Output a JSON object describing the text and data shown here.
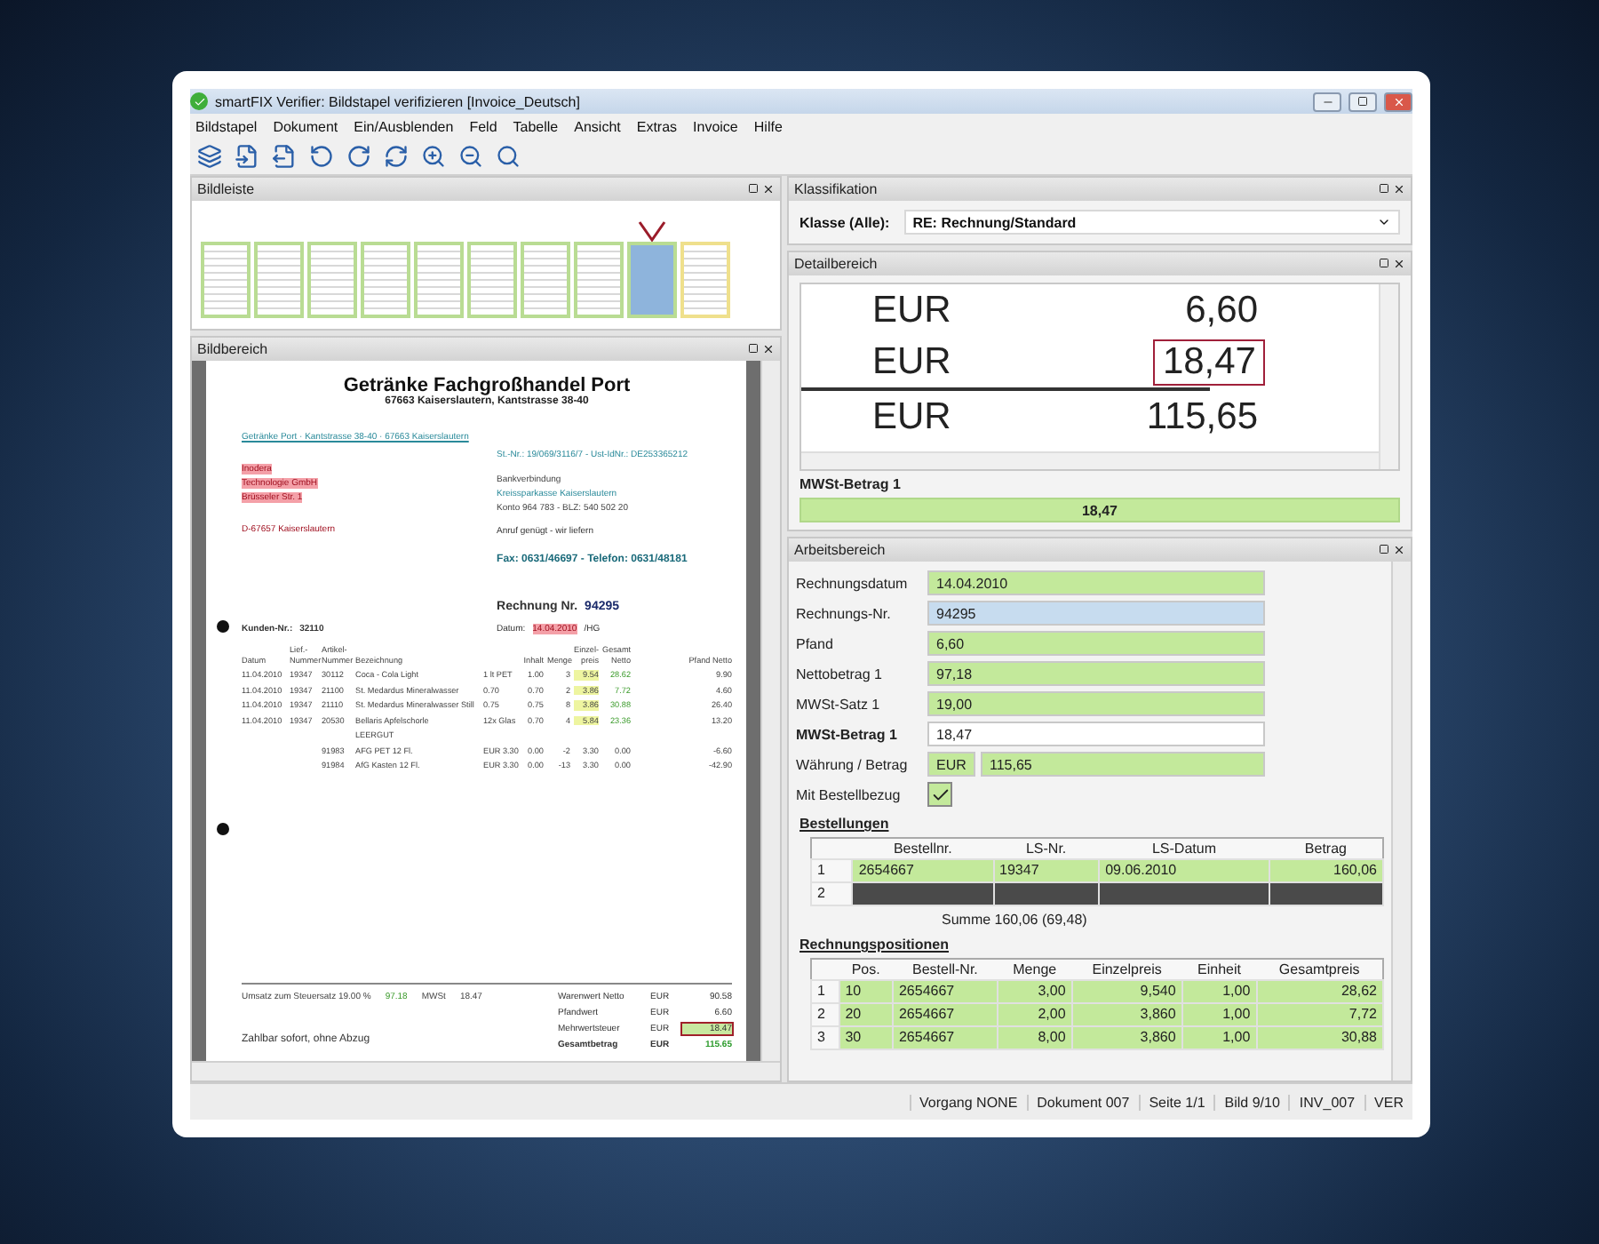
{
  "window": {
    "title": "smartFIX Verifier: Bildstapel verifizieren [Invoice_Deutsch]"
  },
  "menu": [
    "Bildstapel",
    "Dokument",
    "Ein/Ausblenden",
    "Feld",
    "Tabelle",
    "Ansicht",
    "Extras",
    "Invoice",
    "Hilfe"
  ],
  "bildleiste": {
    "title": "Bildleiste",
    "thumbnails": [
      {
        "selected": false,
        "color": "#b9dc93"
      },
      {
        "selected": false,
        "color": "#b9dc93"
      },
      {
        "selected": false,
        "color": "#b9dc93"
      },
      {
        "selected": false,
        "color": "#b9dc93"
      },
      {
        "selected": false,
        "color": "#b9dc93"
      },
      {
        "selected": false,
        "color": "#b9dc93"
      },
      {
        "selected": false,
        "color": "#b9dc93"
      },
      {
        "selected": false,
        "color": "#b9dc93"
      },
      {
        "selected": true,
        "color": "#b9dc93"
      },
      {
        "selected": false,
        "color": "#efe08c"
      }
    ]
  },
  "bildbereich": {
    "title": "Bildbereich",
    "document": {
      "company": "Getränke Fachgroßhandel Port",
      "address": "67663 Kaiserslautern, Kantstrasse 38-40",
      "sender_line": "Getränke Port · Kantstrasse 38-40 · 67663 Kaiserslautern",
      "recipient": [
        "Inodera",
        "Technologie GmbH",
        "Brüsseler Str. 1"
      ],
      "recipient_city": "D-67657 Kaiserslautern",
      "tax_line": "St.-Nr.: 19/069/3116/7 - Ust-IdNr.: DE253365212",
      "bank": [
        "Bankverbindung",
        "Kreissparkasse Kaiserslautern",
        "Konto 964 783 - BLZ: 540 502 20"
      ],
      "note": "Anruf genügt - wir liefern",
      "contact": "Fax: 0631/46697 - Telefon: 0631/48181",
      "invoice_label": "Rechnung Nr.",
      "invoice_no": "94295",
      "customer_label": "Kunden-Nr.:",
      "customer_no": "32110",
      "date_label": "Datum:",
      "date": "14.04.2010",
      "date_suffix": "/HG",
      "columns": [
        "Datum",
        "Lief.-Nummer",
        "Artikel-Nummer",
        "Bezeichnung",
        "",
        "Inhalt",
        "Menge",
        "Einzel-preis",
        "Gesamt Netto",
        "Pfand Netto"
      ],
      "rows": [
        [
          "11.04.2010",
          "19347",
          "30112",
          "Coca - Cola Light",
          "1 lt PET",
          "1.00",
          "3",
          "9.54",
          "28.62",
          "9.90"
        ],
        [
          "11.04.2010",
          "19347",
          "21100",
          "St. Medardus Mineralwasser",
          "0.70",
          "0.70",
          "2",
          "3.86",
          "7.72",
          "4.60"
        ],
        [
          "11.04.2010",
          "19347",
          "21110",
          "St. Medardus Mineralwasser Still",
          "0.75",
          "0.75",
          "8",
          "3.86",
          "30.88",
          "26.40"
        ],
        [
          "11.04.2010",
          "19347",
          "20530",
          "Bellaris Apfelschorle",
          "12x Glas",
          "0.70",
          "4",
          "5.84",
          "23.36",
          "13.20"
        ]
      ],
      "section": "LEERGUT",
      "return_rows": [
        [
          "91983",
          "AFG PET  12 Fl.",
          "EUR  3.30",
          "0.00",
          "-2",
          "3.30",
          "0.00",
          "-6.60"
        ],
        [
          "91984",
          "AfG Kasten  12 Fl.",
          "EUR  3.30",
          "0.00",
          "-13",
          "3.30",
          "0.00",
          "-42.90"
        ]
      ],
      "tax_summary": [
        "Umsatz zum Steuersatz 19.00 %",
        "97.18",
        "MWSt",
        "18.47"
      ],
      "totals": [
        {
          "label": "Warenwert Netto",
          "currency": "EUR",
          "amount": "90.58",
          "kind": "line",
          "marked": false
        },
        {
          "label": "Pfandwert",
          "currency": "EUR",
          "amount": "6.60",
          "kind": "line",
          "marked": false
        },
        {
          "label": "Mehrwertsteuer",
          "currency": "EUR",
          "amount": "18.47",
          "kind": "line",
          "marked": true
        },
        {
          "label": "Gesamtbetrag",
          "currency": "EUR",
          "amount": "115.65",
          "kind": "total",
          "marked": false
        }
      ],
      "payment": "Zahlbar sofort, ohne Abzug"
    }
  },
  "klassifikation": {
    "title": "Klassifikation",
    "label": "Klasse (Alle):",
    "value": "RE: Rechnung/Standard"
  },
  "detailbereich": {
    "title": "Detailbereich",
    "lines": [
      {
        "currency": "EUR",
        "amount": "6,60",
        "highlighted": false
      },
      {
        "currency": "EUR",
        "amount": "18,47",
        "highlighted": true
      },
      {
        "currency": "EUR",
        "amount": "115,65",
        "highlighted": false
      }
    ],
    "field_label": "MWSt-Betrag 1",
    "field_value": "18,47"
  },
  "arbeitsbereich": {
    "title": "Arbeitsbereich",
    "fields": [
      {
        "label": "Rechnungsdatum",
        "value": "14.04.2010",
        "valid": true,
        "selected": false
      },
      {
        "label": "Rechnungs-Nr.",
        "value": "94295",
        "valid": true,
        "selected": true
      },
      {
        "label": "Pfand",
        "value": "6,60",
        "valid": true,
        "selected": false
      },
      {
        "label": "Nettobetrag 1",
        "value": "97,18",
        "valid": true,
        "selected": false
      },
      {
        "label": "MWSt-Satz 1",
        "value": "19,00",
        "valid": true,
        "selected": false
      },
      {
        "label": "MWSt-Betrag 1",
        "value": "18,47",
        "valid": false,
        "selected": false
      }
    ],
    "currency_field": {
      "label": "Währung / Betrag",
      "currency": "EUR",
      "amount": "115,65"
    },
    "checkbox": {
      "label": "Mit Bestellbezug",
      "checked": true
    },
    "orders": {
      "title": "Bestellungen",
      "columns": [
        "Bestellnr.",
        "LS-Nr.",
        "LS-Datum",
        "Betrag"
      ],
      "rows": [
        {
          "index": "1",
          "valid": true,
          "selected": false,
          "cells": [
            "2654667",
            "19347",
            "09.06.2010",
            "160,06"
          ]
        },
        {
          "index": "2",
          "valid": false,
          "selected": true
        }
      ],
      "sum": "Summe 160,06 (69,48)"
    },
    "positions": {
      "title": "Rechnungspositionen",
      "columns": [
        "Pos.",
        "Bestell-Nr.",
        "Menge",
        "Einzelpreis",
        "Einheit",
        "Gesamtpreis"
      ],
      "rows": [
        {
          "index": "1",
          "valid": true,
          "cells": [
            "10",
            "2654667",
            "3,00",
            "9,540",
            "1,00",
            "28,62"
          ]
        },
        {
          "index": "2",
          "valid": true,
          "cells": [
            "20",
            "2654667",
            "2,00",
            "3,860",
            "1,00",
            "7,72"
          ]
        },
        {
          "index": "3",
          "valid": true,
          "cells": [
            "30",
            "2654667",
            "8,00",
            "3,860",
            "1,00",
            "30,88"
          ]
        }
      ]
    }
  },
  "status_bar": [
    "Vorgang NONE",
    "Dokument 007",
    "Seite 1/1",
    "Bild 9/10",
    "INV_007",
    "VER"
  ]
}
